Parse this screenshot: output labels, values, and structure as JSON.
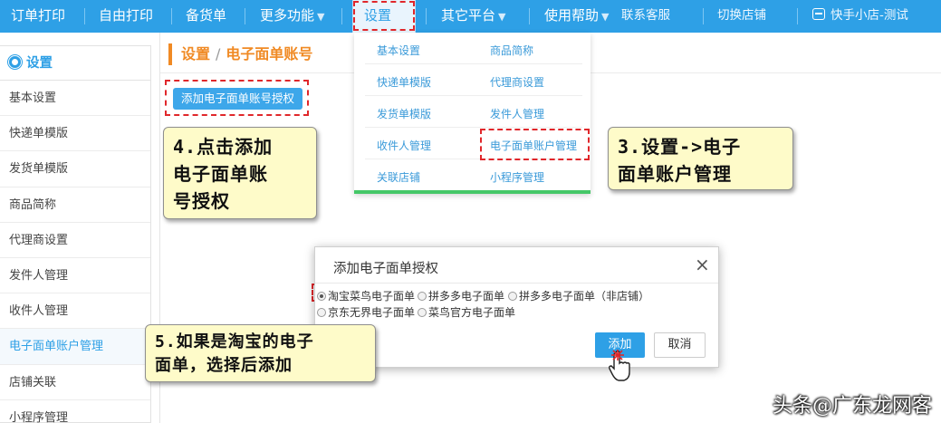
{
  "nav": {
    "items": [
      {
        "label": "订单打印"
      },
      {
        "label": "自由打印"
      },
      {
        "label": "备货单"
      },
      {
        "label": "更多功能"
      },
      {
        "label": "设置"
      },
      {
        "label": "其它平台"
      },
      {
        "label": "使用帮助"
      },
      {
        "label": "联系客服"
      },
      {
        "label": "切换店铺"
      },
      {
        "label": "快手小店-测试"
      }
    ],
    "caret_down": "▼",
    "caret_up": "▲"
  },
  "dropdown": {
    "items": [
      "基本设置",
      "商品简称",
      "快递单模版",
      "代理商设置",
      "发货单模版",
      "发件人管理",
      "收件人管理",
      "电子面单账户管理",
      "关联店铺",
      "小程序管理"
    ]
  },
  "sidebar": {
    "title": "设置",
    "items": [
      "基本设置",
      "快递单模版",
      "发货单模版",
      "商品简称",
      "代理商设置",
      "发件人管理",
      "收件人管理",
      "电子面单账户管理",
      "店铺关联",
      "小程序管理"
    ],
    "active_index": 7
  },
  "breadcrumb": {
    "parent": "设置",
    "separator": "/",
    "current": "电子面单账号"
  },
  "main": {
    "add_account_button": "添加电子面单账号授权"
  },
  "modal": {
    "title": "添加电子面单授权",
    "close": "×",
    "options": [
      {
        "label": "淘宝菜鸟电子面单",
        "checked": true
      },
      {
        "label": "拼多多电子面单",
        "checked": false
      },
      {
        "label": "拼多多电子面单（非店铺）",
        "checked": false
      },
      {
        "label": "京东无界电子面单",
        "checked": false
      },
      {
        "label": "菜鸟官方电子面单",
        "checked": false
      }
    ],
    "add_button": "添加",
    "cancel_button": "取消"
  },
  "annotations": {
    "step3_line1": "3.设置->电子",
    "step3_line2": "面单账户管理",
    "step4_line1": "4.点击添加",
    "step4_line2": "电子面单账",
    "step4_line3": "号授权",
    "step5_line1": "5.如果是淘宝的电子",
    "step5_line2": "面单，选择后添加"
  },
  "watermark": "头条@广东龙网客",
  "colors": {
    "nav_bg": "#2ea0e6",
    "accent_orange": "#f08a24",
    "dashed_highlight": "#e0272b",
    "callout_bg": "#fefbc9",
    "dropdown_underline": "#44c767"
  }
}
